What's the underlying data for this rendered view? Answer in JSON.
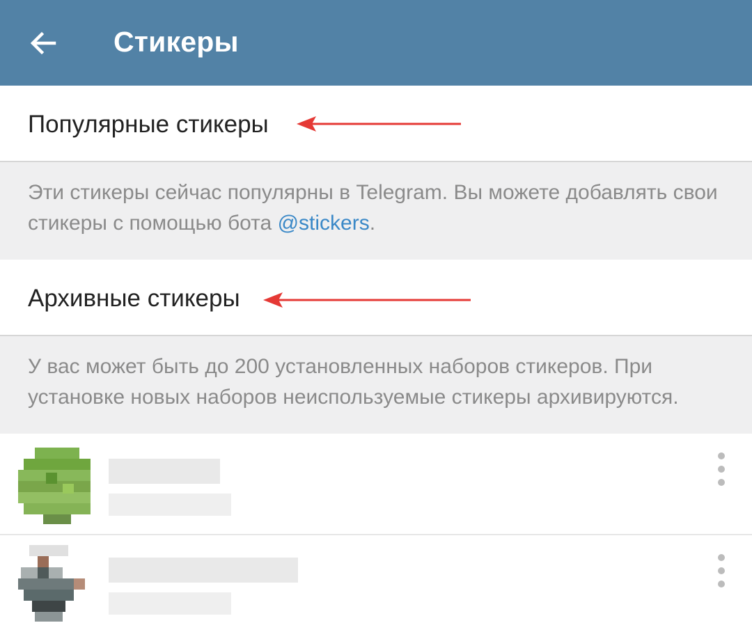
{
  "header": {
    "title": "Стикеры",
    "color": "#5282a6"
  },
  "popular": {
    "label": "Популярные стикеры"
  },
  "popular_info": {
    "text_before": "Эти стикеры сейчас популярны в Telegram. Вы можете добавлять свои стикеры с помощью бота ",
    "link": "@stickers",
    "text_after": "."
  },
  "archived": {
    "label": "Архивные стикеры"
  },
  "archived_info": {
    "text": "У вас может быть до 200 установленных наборов стикеров. При установке новых наборов неиспользуемые стикеры архивируются."
  },
  "annotation_color": "#e53935",
  "sets": [
    {
      "thumb_color": "#7aa64a"
    },
    {
      "thumb_color": "#5b6a6b"
    }
  ]
}
